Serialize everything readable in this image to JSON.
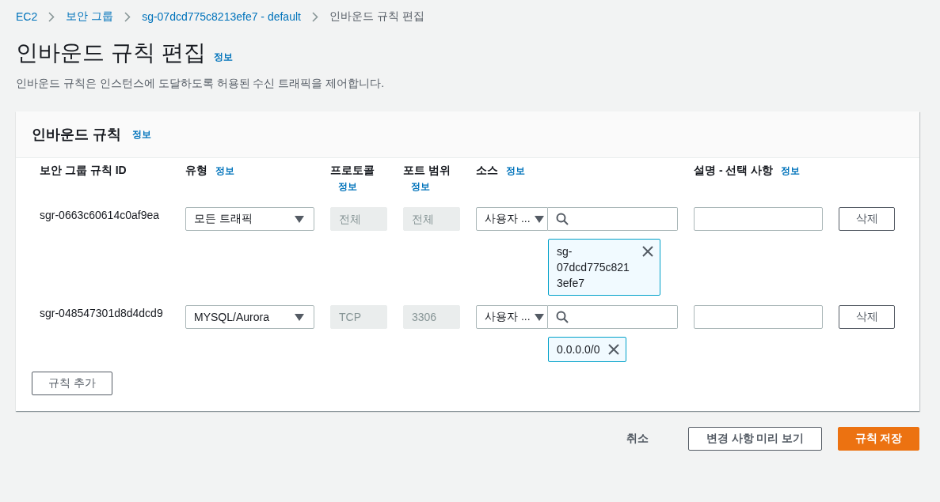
{
  "breadcrumb": [
    {
      "label": "EC2",
      "current": false
    },
    {
      "label": "보안 그룹",
      "current": false
    },
    {
      "label": "sg-07dcd775c8213efe7 - default",
      "current": false
    },
    {
      "label": "인바운드 규칙 편집",
      "current": true
    }
  ],
  "page": {
    "title": "인바운드 규칙 편집",
    "info_link": "정보",
    "description": "인바운드 규칙은 인스턴스에 도달하도록 허용된 수신 트래픽을 제어합니다."
  },
  "panel": {
    "title": "인바운드 규칙",
    "info_link": "정보",
    "columns": [
      {
        "label": "보안 그룹 규칙 ID"
      },
      {
        "label": "유형",
        "info_link": "정보"
      },
      {
        "label": "프로토콜",
        "info_link": "정보"
      },
      {
        "label": "포트 범위",
        "info_link": "정보"
      },
      {
        "label": "소스",
        "info_link": "정보"
      },
      {
        "label": "설명 - 선택 사항",
        "info_link": "정보"
      }
    ],
    "rules": [
      {
        "id": "sgr-0663c60614c0af9ea",
        "type": "모든 트래픽",
        "protocol": {
          "value": "전체",
          "disabled": true
        },
        "port_range": {
          "value": "전체",
          "disabled": true
        },
        "source_type": "사용자 ...",
        "source_tokens": [
          "sg-07dcd775c8213efe7"
        ],
        "delete_button": "삭제"
      },
      {
        "id": "sgr-048547301d8d4dcd9",
        "type": "MYSQL/Aurora",
        "protocol": {
          "value": "TCP",
          "disabled": true
        },
        "port_range": {
          "value": "3306",
          "disabled": true
        },
        "source_type": "사용자 ...",
        "source_tokens": [
          "0.0.0.0/0"
        ],
        "delete_button": "삭제"
      }
    ],
    "add_rule_button": "규칙 추가"
  },
  "footer": {
    "cancel": "취소",
    "preview": "변경 사항 미리 보기",
    "save": "규칙 저장"
  }
}
